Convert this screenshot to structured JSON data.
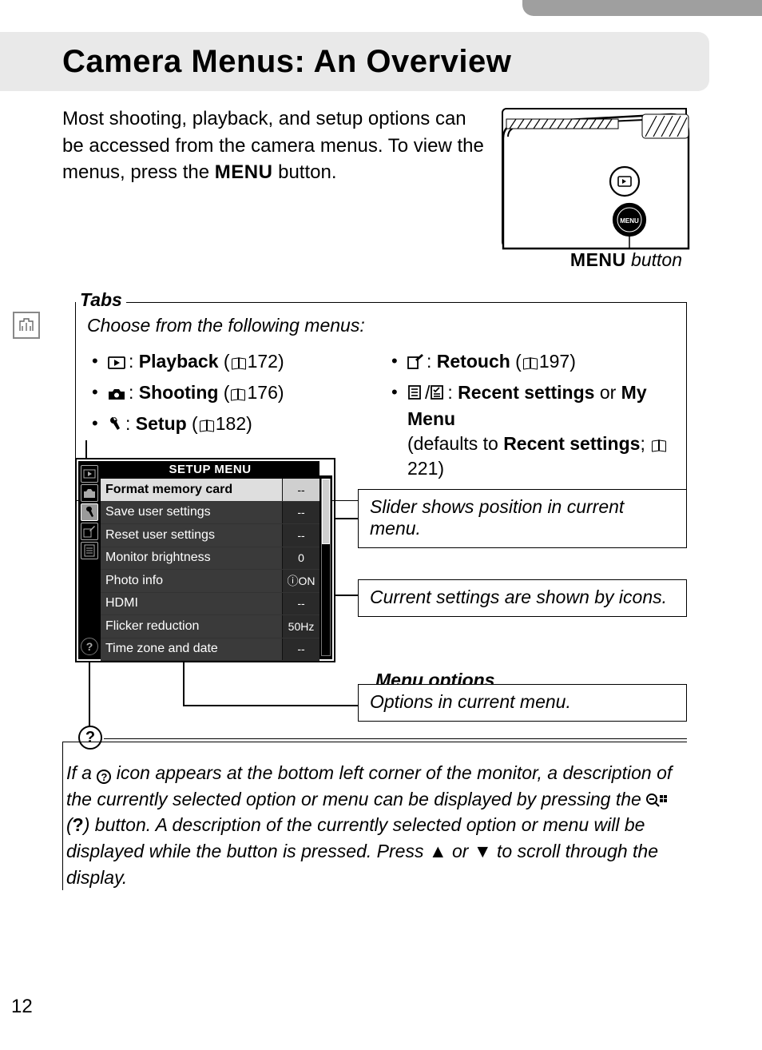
{
  "title": "Camera Menus: An Overview",
  "intro": {
    "line1": "Most shooting, playback, and setup options can be accessed from the camera menus.  To view the menus, press the ",
    "menu_word": "MENU",
    "line2": " button."
  },
  "camera_caption": {
    "menu_word": "MENU",
    "rest": " button"
  },
  "tabs": {
    "heading": "Tabs",
    "choose": "Choose from the following menus:",
    "left": [
      {
        "name": "Playback",
        "page": "172"
      },
      {
        "name": "Shooting",
        "page": "176"
      },
      {
        "name": "Setup",
        "page": "182"
      }
    ],
    "right_retouch": {
      "name": "Retouch",
      "page": "197"
    },
    "right_recent": {
      "bold1": "Recent settings",
      "or": " or ",
      "bold2": "My Menu",
      "def1": "(defaults to ",
      "bold3": "Recent settings",
      "def2": "; ",
      "page": "221",
      "def3": ")"
    }
  },
  "setup_menu": {
    "title": "SETUP MENU",
    "rows": [
      {
        "label": "Format memory card",
        "value": "--",
        "selected": true
      },
      {
        "label": "Save user settings",
        "value": "--"
      },
      {
        "label": "Reset user settings",
        "value": "--"
      },
      {
        "label": "Monitor brightness",
        "value": "0"
      },
      {
        "label": "Photo info",
        "value": "ⓘON"
      },
      {
        "label": "HDMI",
        "value": "--"
      },
      {
        "label": "Flicker reduction",
        "value": "50Hz"
      },
      {
        "label": "Time zone and date",
        "value": "--"
      }
    ]
  },
  "callouts": {
    "slider": "Slider shows position in current menu.",
    "current": "Current settings are shown by icons.",
    "options_heading": "Menu options",
    "options": "Options in current menu."
  },
  "help": {
    "p1a": "If a ",
    "p1b": " icon appears at the bottom left corner of the monitor, a description of the currently selected option or menu can be displayed by pressing the ",
    "p2a": " (",
    "q": "?",
    "p2b": ") button. A description of the currently selected option or menu will be displayed while the button is pressed. Press ",
    "up": "▲",
    "or": " or ",
    "down": "▼",
    "p2c": " to scroll through the display."
  },
  "page_number": "12"
}
